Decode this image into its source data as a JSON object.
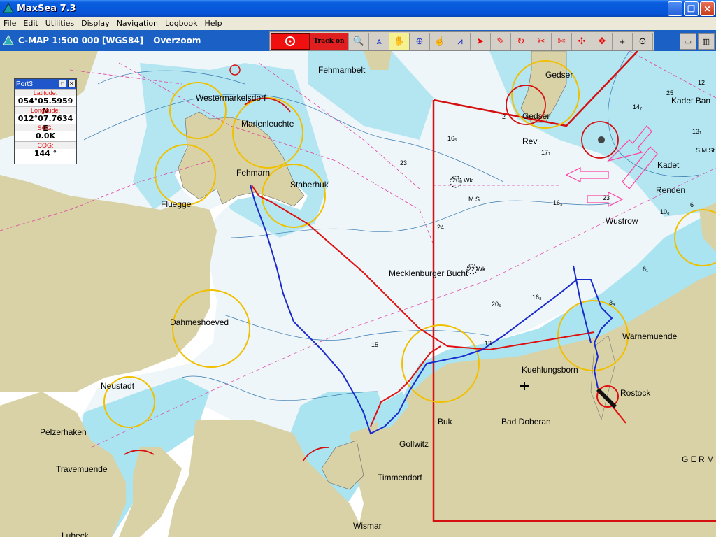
{
  "window": {
    "title": "MaxSea 7.3"
  },
  "menu": [
    "File",
    "Edit",
    "Utilities",
    "Display",
    "Navigation",
    "Logbook",
    "Help"
  ],
  "chart_info": {
    "source": "C-MAP  1:500 000 [WGS84]",
    "mode": "Overzoom"
  },
  "toolbar": {
    "track_label": "Track on"
  },
  "port": {
    "title": "Port3",
    "latitude_label": "Latitude:",
    "latitude": "054°05.5959 N",
    "longitude_label": "Longitude:",
    "longitude": "012°07.7634 E",
    "sog_label": "SOG:",
    "sog": "0.0K",
    "cog_label": "COG:",
    "cog": "144 °"
  },
  "places": {
    "fehmarnbelt": "Fehmarnbelt",
    "gedser1": "Gedser",
    "gedser2": "Gedser",
    "westermarkelsdorf": "Westermarkelsdorf",
    "marienleuchte": "Marienleuchte",
    "fehmarn": "Fehmarn",
    "staberhuk": "Staberhuk",
    "fluegge": "Fluegge",
    "rev": "Rev",
    "kadet_ban": "Kadet Ban",
    "kadet": "Kadet",
    "renden": "Renden",
    "wustrow": "Wustrow",
    "ms": "M.S",
    "mecklenburger": "Mecklenburger Bucht",
    "dahmeshoeved": "Dahmeshoeved",
    "warnemuende": "Warnemuende",
    "kuehlungsborn": "Kuehlungsborn",
    "rostock": "Rostock",
    "neustadt": "Neustadt",
    "pelzerhaken": "Pelzerhaken",
    "travemuende": "Travemuende",
    "buk": "Buk",
    "bad_doberan": "Bad Doberan",
    "gollwitz": "Gollwitz",
    "timmendorf": "Timmendorf",
    "wismar": "Wismar",
    "lubeck": "Lubeck",
    "germ": "G E R M",
    "sms": "S.M.St",
    "wk1": "20₅ Wk",
    "wk2": "22 Wk"
  },
  "depths": {
    "d12": "12",
    "d25": "25",
    "d14": "14₇",
    "d13": "13₁",
    "d16a": "16₅",
    "d17": "17₁",
    "d23a": "23",
    "d24": "24",
    "d16b": "16₅",
    "d23b": "23",
    "d10": "10₆",
    "d6": "6₁",
    "d16c": "16₈",
    "d20": "20₅",
    "d15": "15",
    "d13b": "13",
    "d34": "3₄",
    "d2": "2",
    "d6b": "6"
  },
  "colors": {
    "land": "#d9d2a6",
    "shallow": "#a9e4f0",
    "medium": "#e8f4f8",
    "deep": "#ffffff",
    "route": "#e01010",
    "track": "#1a2acc",
    "light": "#f0c000",
    "border": "#cc1010"
  }
}
